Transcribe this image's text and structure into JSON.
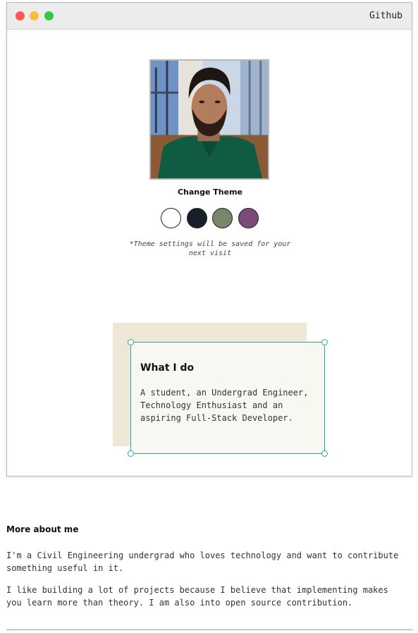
{
  "window": {
    "title_link": "Github"
  },
  "profile": {
    "photo_alt": "profile photo"
  },
  "theme": {
    "title": "Change Theme",
    "swatches": [
      {
        "name": "light",
        "color": "#ffffff"
      },
      {
        "name": "dark",
        "color": "#17202a"
      },
      {
        "name": "green",
        "color": "#78866b"
      },
      {
        "name": "purple",
        "color": "#7b4a7a"
      }
    ],
    "note": "*Theme settings will be saved for your next visit"
  },
  "what_i_do": {
    "title": "What I do",
    "text": "A student, an Undergrad Engineer, Technology Enthusiast and an aspiring Full-Stack Developer."
  },
  "more_about": {
    "title": "More about me",
    "paragraphs": [
      "I'm a Civil Engineering undergrad who loves technology and want to contribute something useful in it.",
      "I like building a lot of projects because I believe that implementing makes you learn more than theory. I am also into open source contribution."
    ]
  }
}
